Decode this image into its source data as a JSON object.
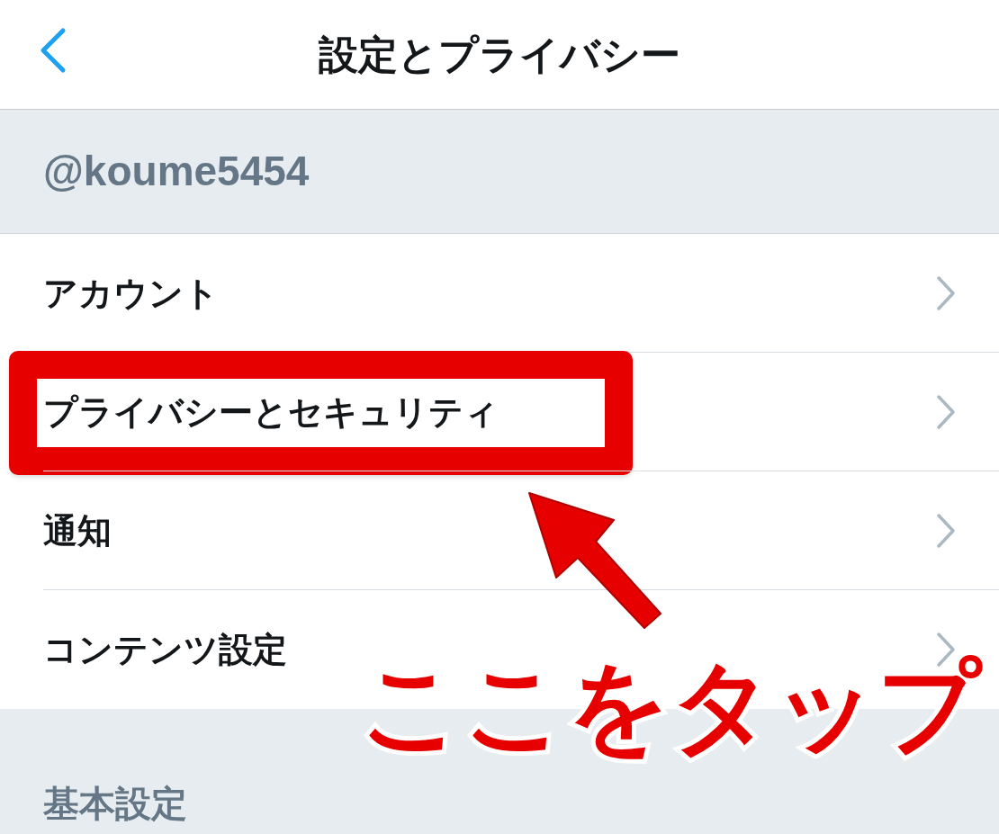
{
  "nav_bar": {
    "title": "設定とプライバシー"
  },
  "account_header": "@koume5454",
  "items": [
    {
      "label": "アカウント",
      "highlighted": false
    },
    {
      "label": "プライバシーとセキュリティ",
      "highlighted": true
    },
    {
      "label": "通知",
      "highlighted": false
    },
    {
      "label": "コンテンツ設定",
      "highlighted": false
    }
  ],
  "section_header": "基本設定",
  "callout": {
    "text": "ここをタップ"
  }
}
